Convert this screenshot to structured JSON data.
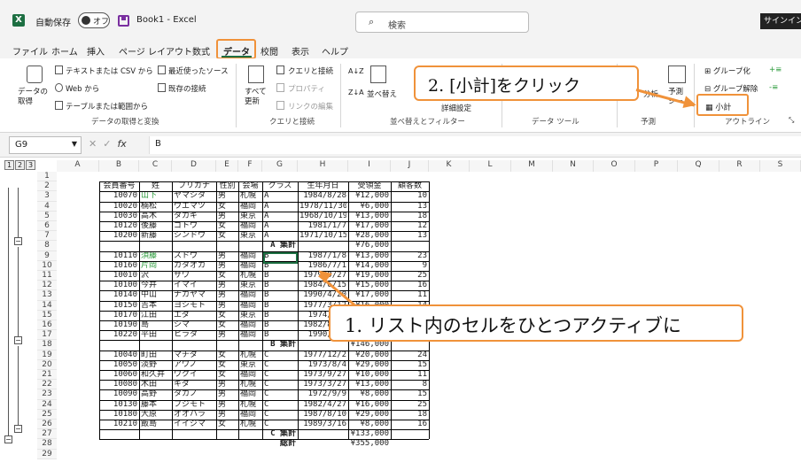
{
  "titlebar": {
    "app_icon": "excel-icon",
    "autosave_label": "自動保存",
    "toggle_label": "オフ",
    "doc_title": "Book1  -  Excel",
    "search_placeholder": "検索",
    "signin_label": "サインイン"
  },
  "menu": {
    "items": [
      "ファイル",
      "ホーム",
      "挿入",
      "ページ レイアウト",
      "数式",
      "データ",
      "校閲",
      "表示",
      "ヘルプ"
    ],
    "active": "データ"
  },
  "ribbon": {
    "get_data": {
      "label": "データの\n取得",
      "csv": "テキストまたは CSV から",
      "web": "Web から",
      "table": "テーブルまたは範囲から",
      "recent": "最近使ったソース",
      "existing": "既存の接続",
      "group": "データの取得と変換"
    },
    "queries": {
      "refresh": "すべて\n更新",
      "queries": "クエリと接続",
      "props": "プロパティ",
      "links": "リンクの編集",
      "group": "クエリと接続"
    },
    "sort": {
      "sort_label": "並べ替え",
      "group": "並べ替えとフィルター",
      "advanced": "詳細設定"
    },
    "tools": {
      "analysis": "分析",
      "group": "データ ツール"
    },
    "forecast": {
      "label": "予測\nシート",
      "group": "予測"
    },
    "outline": {
      "group_btn": "グループ化",
      "ungroup_btn": "グループ解除",
      "subtotal_btn": "小計",
      "group": "アウトライン"
    }
  },
  "callouts": {
    "step2": "2. [小計]をクリック",
    "step1": "1. リスト内のセルをひとつアクティブに"
  },
  "formula_bar": {
    "namebox": "G9",
    "content": "B",
    "fx": "fx"
  },
  "outline_levels": [
    "1",
    "2",
    "3"
  ],
  "columns": [
    "A",
    "B",
    "C",
    "D",
    "E",
    "F",
    "G",
    "H",
    "I",
    "J",
    "K",
    "L",
    "M",
    "N",
    "O",
    "P",
    "Q",
    "R",
    "S"
  ],
  "rows": [
    "1",
    "2",
    "3",
    "4",
    "5",
    "6",
    "7",
    "8",
    "9",
    "10",
    "11",
    "12",
    "13",
    "14",
    "15",
    "16",
    "17",
    "18",
    "19",
    "20",
    "21",
    "22",
    "23",
    "24",
    "25",
    "26",
    "27",
    "28",
    "29"
  ],
  "table": {
    "header": [
      "会員番号",
      "姓",
      "フリガナ",
      "性別",
      "会場",
      "クラス",
      "生年月日",
      "受領金",
      "顧客数"
    ],
    "rows": [
      [
        "10070",
        "山下",
        "ヤマシタ",
        "男",
        "札幌",
        "A",
        "1984/8/28",
        "¥12,000",
        "10"
      ],
      [
        "10020",
        "楠松",
        "ウエマツ",
        "女",
        "福岡",
        "A",
        "1978/11/30",
        "¥6,000",
        "13"
      ],
      [
        "10030",
        "高木",
        "タカギ",
        "男",
        "東京",
        "A",
        "1968/10/19",
        "¥13,000",
        "18"
      ],
      [
        "10120",
        "後藤",
        "ゴトウ",
        "女",
        "福岡",
        "A",
        "1981/1/7",
        "¥17,000",
        "12"
      ],
      [
        "10200",
        "新藤",
        "シンドウ",
        "女",
        "東京",
        "A",
        "1971/10/15",
        "¥28,000",
        "13"
      ],
      [
        "",
        "",
        "",
        "",
        "",
        "A 集計",
        "",
        "¥76,000",
        ""
      ],
      [
        "10110",
        "須藤",
        "スドウ",
        "男",
        "福岡",
        "B",
        "1987/1/8",
        "¥13,000",
        "23"
      ],
      [
        "10160",
        "片岡",
        "カタオカ",
        "男",
        "福岡",
        "B",
        "1986/7/1",
        "¥14,000",
        "9"
      ],
      [
        "10010",
        "沢",
        "サワ",
        "女",
        "札幌",
        "B",
        "1979/9/27",
        "¥19,000",
        "25"
      ],
      [
        "10100",
        "今井",
        "イマイ",
        "男",
        "東京",
        "B",
        "1984/6/15",
        "¥15,000",
        "16"
      ],
      [
        "10140",
        "中山",
        "ナカヤマ",
        "男",
        "福岡",
        "B",
        "1990/4/20",
        "¥17,000",
        "11"
      ],
      [
        "10150",
        "吉本",
        "ヨシモト",
        "男",
        "福岡",
        "B",
        "1977/3/12",
        "¥16,000",
        "14"
      ],
      [
        "10170",
        "江田",
        "エダ",
        "女",
        "東京",
        "B",
        "1974/5/1",
        "¥17,000",
        "15"
      ],
      [
        "10190",
        "島",
        "シマ",
        "女",
        "福岡",
        "B",
        "1982/8/11",
        "¥16,000",
        "17"
      ],
      [
        "10220",
        "平田",
        "ヒラタ",
        "男",
        "福岡",
        "B",
        "1990/1/2",
        "¥19,000",
        "13"
      ],
      [
        "",
        "",
        "",
        "",
        "",
        "B 集計",
        "",
        "¥146,000",
        ""
      ],
      [
        "10040",
        "町田",
        "マチダ",
        "女",
        "札幌",
        "C",
        "1977/12/2",
        "¥20,000",
        "24"
      ],
      [
        "10050",
        "淡野",
        "アワノ",
        "女",
        "東京",
        "C",
        "1973/8/4",
        "¥29,000",
        "15"
      ],
      [
        "10060",
        "和久井",
        "ワクイ",
        "女",
        "福岡",
        "C",
        "1973/9/27",
        "¥10,000",
        "11"
      ],
      [
        "10080",
        "木田",
        "キダ",
        "男",
        "札幌",
        "C",
        "1973/3/27",
        "¥13,000",
        "8"
      ],
      [
        "10090",
        "高野",
        "タカノ",
        "男",
        "福岡",
        "C",
        "1972/9/9",
        "¥8,000",
        "15"
      ],
      [
        "10130",
        "藤本",
        "フジモト",
        "男",
        "札幌",
        "C",
        "1982/4/27",
        "¥16,000",
        "25"
      ],
      [
        "10180",
        "大原",
        "オオハラ",
        "男",
        "福岡",
        "C",
        "1987/8/10",
        "¥29,000",
        "18"
      ],
      [
        "10210",
        "飯島",
        "イイジマ",
        "女",
        "札幌",
        "C",
        "1989/3/16",
        "¥8,000",
        "16"
      ],
      [
        "",
        "",
        "",
        "",
        "",
        "C 集計",
        "",
        "¥133,000",
        ""
      ],
      [
        "",
        "",
        "",
        "",
        "",
        "総計",
        "",
        "¥355,000",
        ""
      ]
    ]
  },
  "colors": {
    "accent": "#f0923a",
    "excel_green": "#1d6f42",
    "name_green": "#2a9a3a"
  }
}
